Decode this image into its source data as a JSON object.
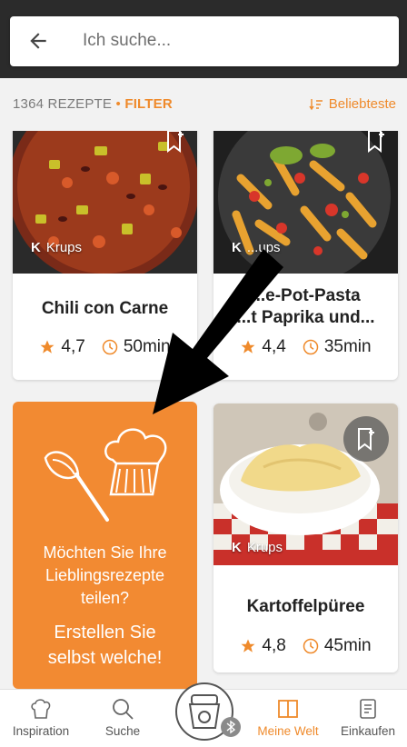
{
  "search": {
    "placeholder": "Ich suche..."
  },
  "filterbar": {
    "count": "1364 REZEPTE",
    "separator": "•",
    "filter_label": "FILTER",
    "sort_label": "Beliebteste"
  },
  "recipes": [
    {
      "title": "Chili con Carne",
      "brand": "Krups",
      "rating": "4,7",
      "time": "50min"
    },
    {
      "title_line1": "...e-Pot-Pasta",
      "title_line2": "...t Paprika und...",
      "brand": "...ups",
      "rating": "4,4",
      "time": "35min"
    },
    {
      "title": "Kartoffelpüree",
      "brand": "Krups",
      "rating": "4,8",
      "time": "45min"
    }
  ],
  "promo": {
    "line1": "Möchten Sie Ihre",
    "line2": "Lieblingsrezepte",
    "line3": "teilen?",
    "cta1": "Erstellen Sie",
    "cta2": "selbst welche!"
  },
  "nav": {
    "inspiration": "Inspiration",
    "suche": "Suche",
    "meine_welt": "Meine Welt",
    "einkaufen": "Einkaufen"
  },
  "colors": {
    "accent": "#ef8a2b",
    "promo": "#f28a32",
    "topbar": "#2b2b2b"
  }
}
